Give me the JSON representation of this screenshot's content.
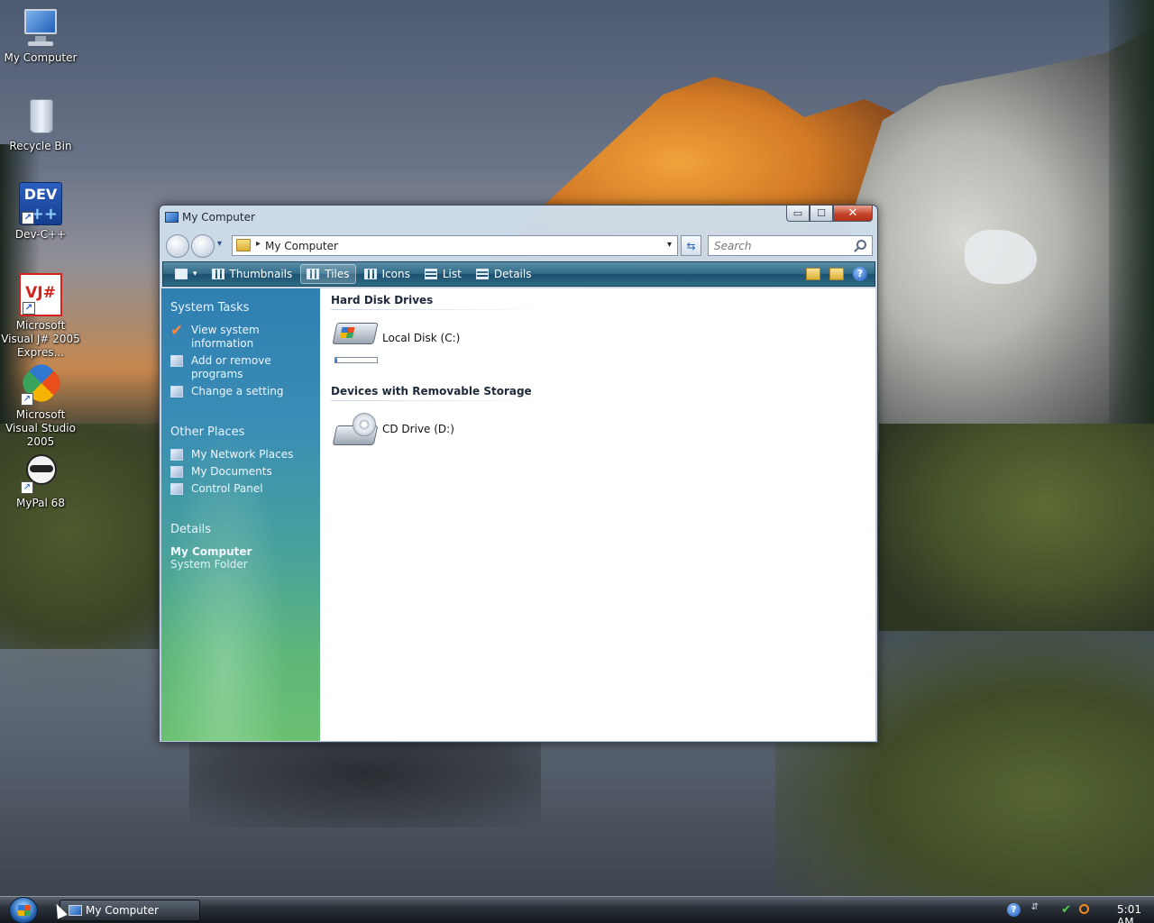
{
  "desktop": {
    "icons": [
      {
        "label": "My Computer"
      },
      {
        "label": "Recycle Bin"
      },
      {
        "label": "Dev-C++",
        "glyph": "DEV",
        "glyph2": "++"
      },
      {
        "label": "Microsoft Visual J# 2005 Expres...",
        "glyph": "VJ#"
      },
      {
        "label": "Microsoft Visual Studio 2005"
      },
      {
        "label": "MyPal 68"
      }
    ],
    "shortcut_glyph": "↗"
  },
  "window": {
    "title": "My Computer",
    "buttons": {
      "minimize": "▭",
      "maximize": "☐",
      "close": "✕"
    },
    "address": {
      "separator": "▸",
      "path": "My Computer",
      "dropdown": "▾",
      "nav_dropdown": "▾",
      "refresh": "⇆"
    },
    "search": {
      "placeholder": "Search"
    },
    "commandbar": {
      "view_caret": "▾",
      "items": [
        {
          "label": "Thumbnails",
          "active": false
        },
        {
          "label": "Tiles",
          "active": true
        },
        {
          "label": "Icons",
          "active": false
        },
        {
          "label": "List",
          "active": false
        },
        {
          "label": "Details",
          "active": false
        }
      ],
      "help": "?"
    },
    "left_pane": {
      "system_tasks": {
        "title": "System Tasks",
        "items": [
          {
            "label": "View system information",
            "icon": "checkmark-icon"
          },
          {
            "label": "Add or remove programs",
            "icon": "programs-icon"
          },
          {
            "label": "Change a setting",
            "icon": "settings-icon"
          }
        ]
      },
      "other_places": {
        "title": "Other Places",
        "items": [
          {
            "label": "My Network Places",
            "icon": "network-icon"
          },
          {
            "label": "My Documents",
            "icon": "documents-icon"
          },
          {
            "label": "Control Panel",
            "icon": "control-panel-icon"
          }
        ]
      },
      "details": {
        "title": "Details",
        "name": "My Computer",
        "type": "System Folder"
      }
    },
    "content": {
      "groups": [
        {
          "title": "Hard Disk Drives",
          "drives": [
            {
              "label": "Local Disk (C:)",
              "used_fraction": 0.05
            }
          ]
        },
        {
          "title": "Devices with Removable Storage",
          "drives": [
            {
              "label": "CD Drive (D:)"
            }
          ]
        }
      ]
    }
  },
  "taskbar": {
    "task_button": "My Computer",
    "tray_help": "?",
    "tray_arrow": "⇵",
    "tray_network": "✔",
    "clock": "5:01 AM"
  },
  "colors": {
    "commandbar": "#2f6a86",
    "left_pane_top": "#2f7fb2",
    "left_pane_bottom": "#6ac070",
    "close_button": "#c7442a"
  }
}
